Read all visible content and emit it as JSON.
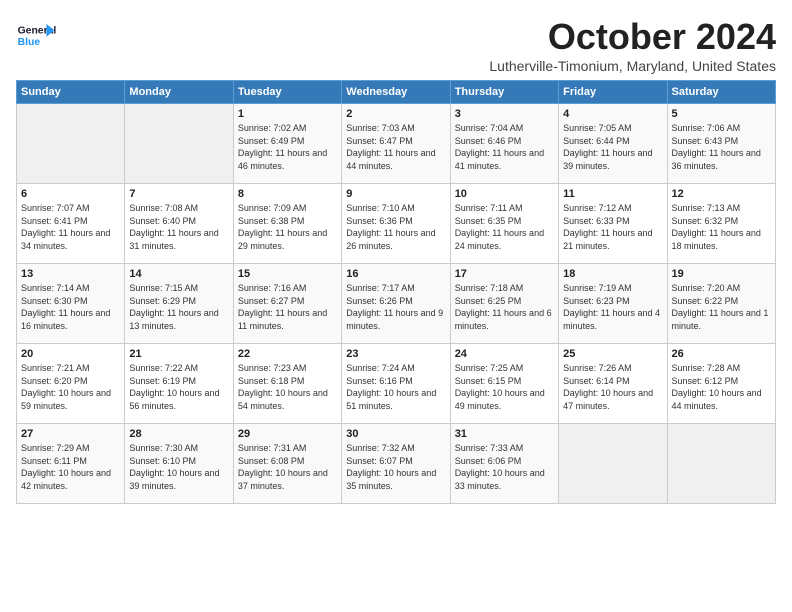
{
  "header": {
    "logo_line1": "General",
    "logo_line2": "Blue",
    "month": "October 2024",
    "location": "Lutherville-Timonium, Maryland, United States"
  },
  "weekdays": [
    "Sunday",
    "Monday",
    "Tuesday",
    "Wednesday",
    "Thursday",
    "Friday",
    "Saturday"
  ],
  "weeks": [
    [
      {
        "day": "",
        "info": ""
      },
      {
        "day": "",
        "info": ""
      },
      {
        "day": "1",
        "info": "Sunrise: 7:02 AM\nSunset: 6:49 PM\nDaylight: 11 hours and 46 minutes."
      },
      {
        "day": "2",
        "info": "Sunrise: 7:03 AM\nSunset: 6:47 PM\nDaylight: 11 hours and 44 minutes."
      },
      {
        "day": "3",
        "info": "Sunrise: 7:04 AM\nSunset: 6:46 PM\nDaylight: 11 hours and 41 minutes."
      },
      {
        "day": "4",
        "info": "Sunrise: 7:05 AM\nSunset: 6:44 PM\nDaylight: 11 hours and 39 minutes."
      },
      {
        "day": "5",
        "info": "Sunrise: 7:06 AM\nSunset: 6:43 PM\nDaylight: 11 hours and 36 minutes."
      }
    ],
    [
      {
        "day": "6",
        "info": "Sunrise: 7:07 AM\nSunset: 6:41 PM\nDaylight: 11 hours and 34 minutes."
      },
      {
        "day": "7",
        "info": "Sunrise: 7:08 AM\nSunset: 6:40 PM\nDaylight: 11 hours and 31 minutes."
      },
      {
        "day": "8",
        "info": "Sunrise: 7:09 AM\nSunset: 6:38 PM\nDaylight: 11 hours and 29 minutes."
      },
      {
        "day": "9",
        "info": "Sunrise: 7:10 AM\nSunset: 6:36 PM\nDaylight: 11 hours and 26 minutes."
      },
      {
        "day": "10",
        "info": "Sunrise: 7:11 AM\nSunset: 6:35 PM\nDaylight: 11 hours and 24 minutes."
      },
      {
        "day": "11",
        "info": "Sunrise: 7:12 AM\nSunset: 6:33 PM\nDaylight: 11 hours and 21 minutes."
      },
      {
        "day": "12",
        "info": "Sunrise: 7:13 AM\nSunset: 6:32 PM\nDaylight: 11 hours and 18 minutes."
      }
    ],
    [
      {
        "day": "13",
        "info": "Sunrise: 7:14 AM\nSunset: 6:30 PM\nDaylight: 11 hours and 16 minutes."
      },
      {
        "day": "14",
        "info": "Sunrise: 7:15 AM\nSunset: 6:29 PM\nDaylight: 11 hours and 13 minutes."
      },
      {
        "day": "15",
        "info": "Sunrise: 7:16 AM\nSunset: 6:27 PM\nDaylight: 11 hours and 11 minutes."
      },
      {
        "day": "16",
        "info": "Sunrise: 7:17 AM\nSunset: 6:26 PM\nDaylight: 11 hours and 9 minutes."
      },
      {
        "day": "17",
        "info": "Sunrise: 7:18 AM\nSunset: 6:25 PM\nDaylight: 11 hours and 6 minutes."
      },
      {
        "day": "18",
        "info": "Sunrise: 7:19 AM\nSunset: 6:23 PM\nDaylight: 11 hours and 4 minutes."
      },
      {
        "day": "19",
        "info": "Sunrise: 7:20 AM\nSunset: 6:22 PM\nDaylight: 11 hours and 1 minute."
      }
    ],
    [
      {
        "day": "20",
        "info": "Sunrise: 7:21 AM\nSunset: 6:20 PM\nDaylight: 10 hours and 59 minutes."
      },
      {
        "day": "21",
        "info": "Sunrise: 7:22 AM\nSunset: 6:19 PM\nDaylight: 10 hours and 56 minutes."
      },
      {
        "day": "22",
        "info": "Sunrise: 7:23 AM\nSunset: 6:18 PM\nDaylight: 10 hours and 54 minutes."
      },
      {
        "day": "23",
        "info": "Sunrise: 7:24 AM\nSunset: 6:16 PM\nDaylight: 10 hours and 51 minutes."
      },
      {
        "day": "24",
        "info": "Sunrise: 7:25 AM\nSunset: 6:15 PM\nDaylight: 10 hours and 49 minutes."
      },
      {
        "day": "25",
        "info": "Sunrise: 7:26 AM\nSunset: 6:14 PM\nDaylight: 10 hours and 47 minutes."
      },
      {
        "day": "26",
        "info": "Sunrise: 7:28 AM\nSunset: 6:12 PM\nDaylight: 10 hours and 44 minutes."
      }
    ],
    [
      {
        "day": "27",
        "info": "Sunrise: 7:29 AM\nSunset: 6:11 PM\nDaylight: 10 hours and 42 minutes."
      },
      {
        "day": "28",
        "info": "Sunrise: 7:30 AM\nSunset: 6:10 PM\nDaylight: 10 hours and 39 minutes."
      },
      {
        "day": "29",
        "info": "Sunrise: 7:31 AM\nSunset: 6:08 PM\nDaylight: 10 hours and 37 minutes."
      },
      {
        "day": "30",
        "info": "Sunrise: 7:32 AM\nSunset: 6:07 PM\nDaylight: 10 hours and 35 minutes."
      },
      {
        "day": "31",
        "info": "Sunrise: 7:33 AM\nSunset: 6:06 PM\nDaylight: 10 hours and 33 minutes."
      },
      {
        "day": "",
        "info": ""
      },
      {
        "day": "",
        "info": ""
      }
    ]
  ]
}
